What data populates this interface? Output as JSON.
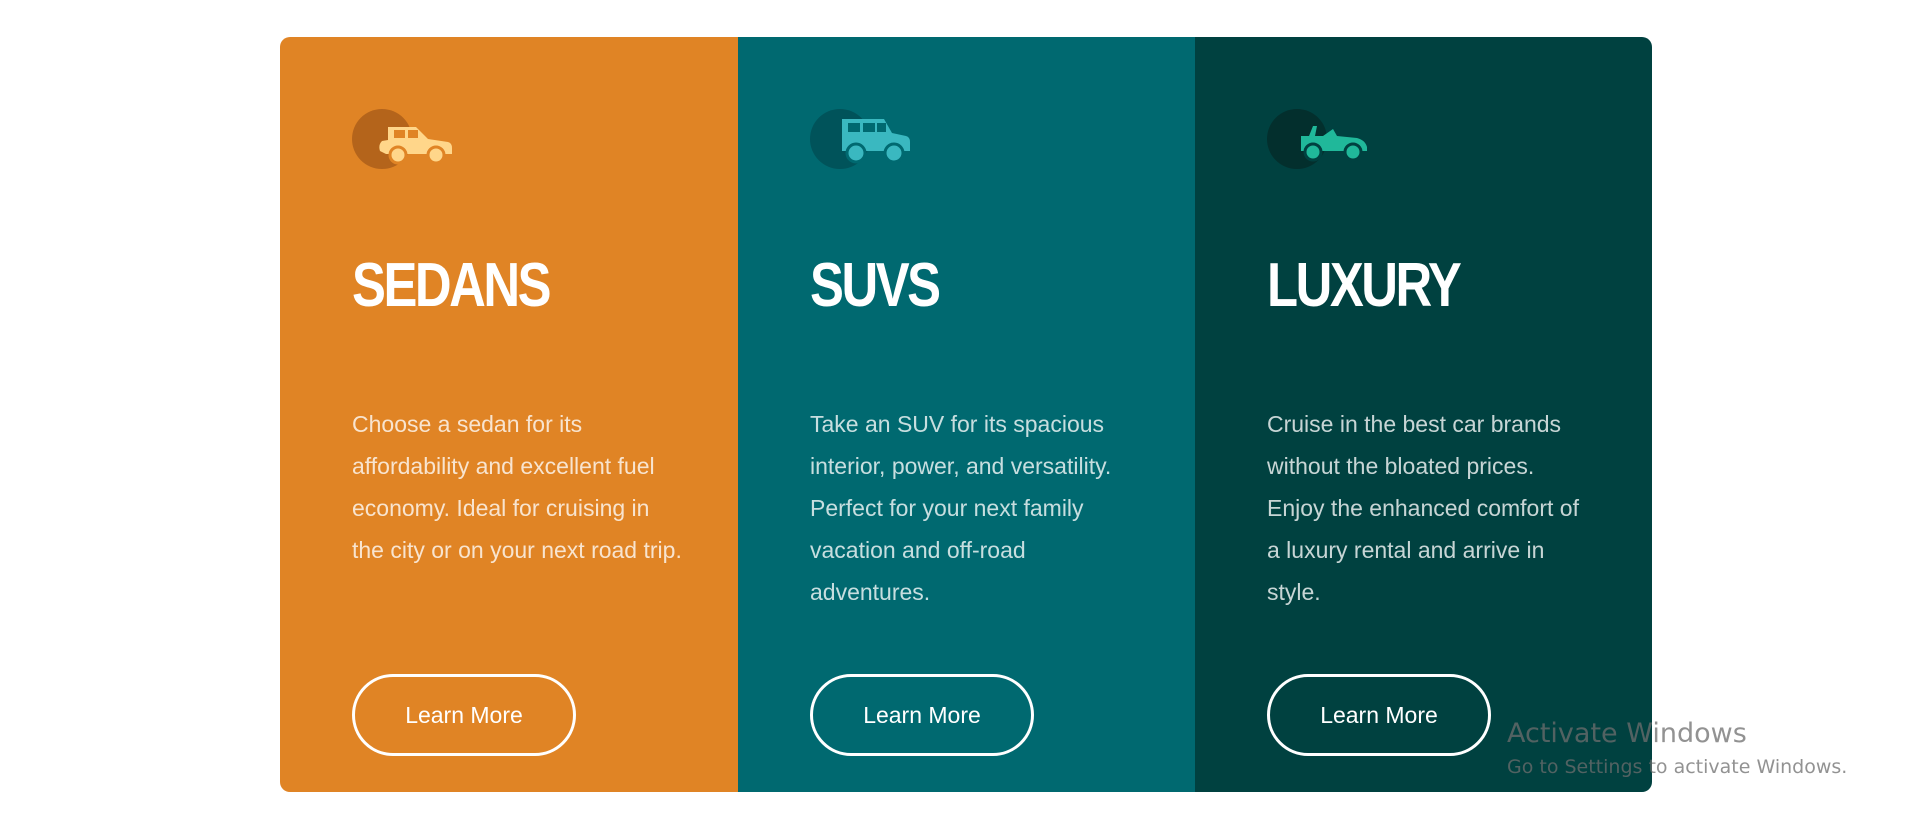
{
  "cards": [
    {
      "title": "SEDANS",
      "icon": "sedan-car-icon",
      "text": "Choose a sedan for its affordability and excellent fuel economy. Ideal for cruising in the city or on your next road trip.",
      "button_label": "Learn More",
      "background": "#e08425",
      "icon_color": "#ffd68a",
      "circle_color": "#b4641b"
    },
    {
      "title": "SUVS",
      "icon": "suv-car-icon",
      "text": "Take an SUV for its spacious interior, power, and versatility. Perfect for your next family vacation and off-road adventures.",
      "button_label": "Learn More",
      "background": "#006970",
      "icon_color": "#3ab8c0",
      "circle_color": "#00535a"
    },
    {
      "title": "LUXURY",
      "icon": "convertible-car-icon",
      "text": "Cruise in the best car brands without the bloated prices. Enjoy the enhanced comfort of a luxury rental and arrive in style.",
      "button_label": "Learn More",
      "background": "#004140",
      "icon_color": "#20b89a",
      "circle_color": "#032f2d"
    }
  ],
  "watermark": {
    "title": "Activate Windows",
    "subtitle": "Go to Settings to activate Windows."
  }
}
